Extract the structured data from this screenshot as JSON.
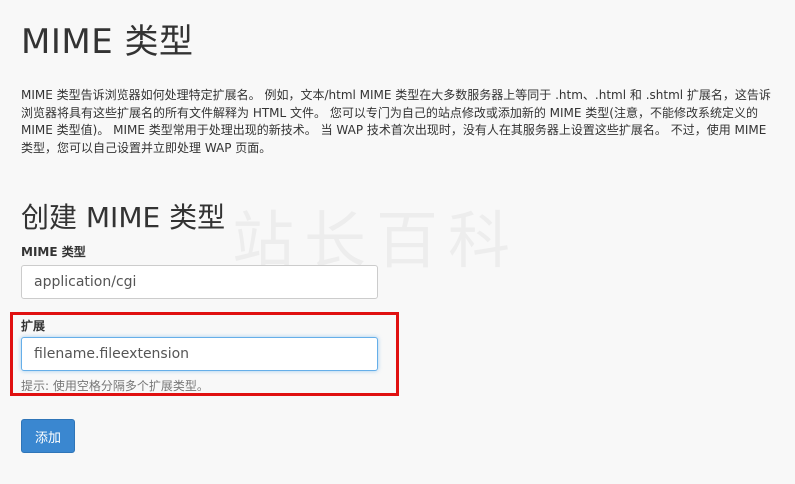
{
  "header": {
    "title": "MIME 类型"
  },
  "intro": {
    "text": "MIME 类型告诉浏览器如何处理特定扩展名。 例如，文本/html MIME 类型在大多数服务器上等同于 .htm、.html 和 .shtml 扩展名，这告诉浏览器将具有这些扩展名的所有文件解释为 HTML 文件。 您可以专门为自己的站点修改或添加新的 MIME 类型(注意，不能修改系统定义的 MIME 类型值)。 MIME 类型常用于处理出现的新技术。 当 WAP 技术首次出现时，没有人在其服务器上设置这些扩展名。 不过，使用 MIME 类型，您可以自己设置并立即处理 WAP 页面。"
  },
  "form": {
    "section_title": "创建 MIME 类型",
    "mime_label": "MIME 类型",
    "mime_value": "application/cgi",
    "extension_label": "扩展",
    "extension_value": "filename.fileextension",
    "extension_hint": "提示: 使用空格分隔多个扩展类型。",
    "add_button_label": "添加"
  },
  "watermark": {
    "text": "站长百科"
  },
  "colors": {
    "accent": "#3a87d0",
    "highlight": "#e01010",
    "focus_border": "#66afe9"
  }
}
